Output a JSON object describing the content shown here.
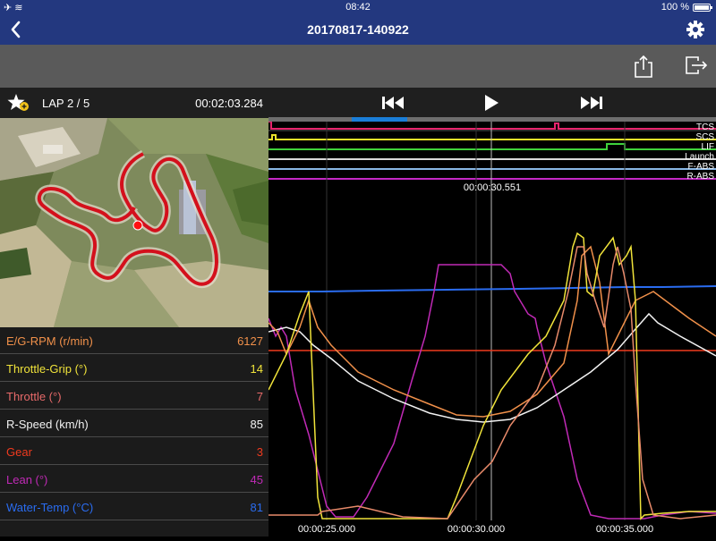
{
  "status": {
    "time": "08:42",
    "battery": "100 %"
  },
  "header": {
    "title": "20170817-140922"
  },
  "lap": {
    "label": "LAP 2 / 5",
    "time": "00:02:03.284"
  },
  "cursor_time": "00:00:30.551",
  "time_ticks": [
    "00:00:25.000",
    "00:00:30.000",
    "00:00:35.000"
  ],
  "channels": [
    {
      "label": "TCS",
      "color": "#e6246c"
    },
    {
      "label": "SCS",
      "color": "#e8e22a"
    },
    {
      "label": "LIF",
      "color": "#3fd23c"
    },
    {
      "label": "Launch",
      "color": "#d9d9d9"
    },
    {
      "label": "F-ABS",
      "color": "#8ab8e6"
    },
    {
      "label": "R-ABS",
      "color": "#c428c4"
    }
  ],
  "params": [
    {
      "label": "E/G-RPM (r/min)",
      "value": "6127",
      "color": "#f0904a"
    },
    {
      "label": "Throttle-Grip (°)",
      "value": "14",
      "color": "#f0e33a"
    },
    {
      "label": "Throttle (°)",
      "value": "7",
      "color": "#e86a6a"
    },
    {
      "label": "R-Speed (km/h)",
      "value": "85",
      "color": "#f2f2f2"
    },
    {
      "label": "Gear",
      "value": "3",
      "color": "#f03a1e"
    },
    {
      "label": "Lean (°)",
      "value": "45",
      "color": "#c02ab6"
    },
    {
      "label": "Water-Temp (°C)",
      "value": "81",
      "color": "#2a6cf0"
    }
  ]
}
